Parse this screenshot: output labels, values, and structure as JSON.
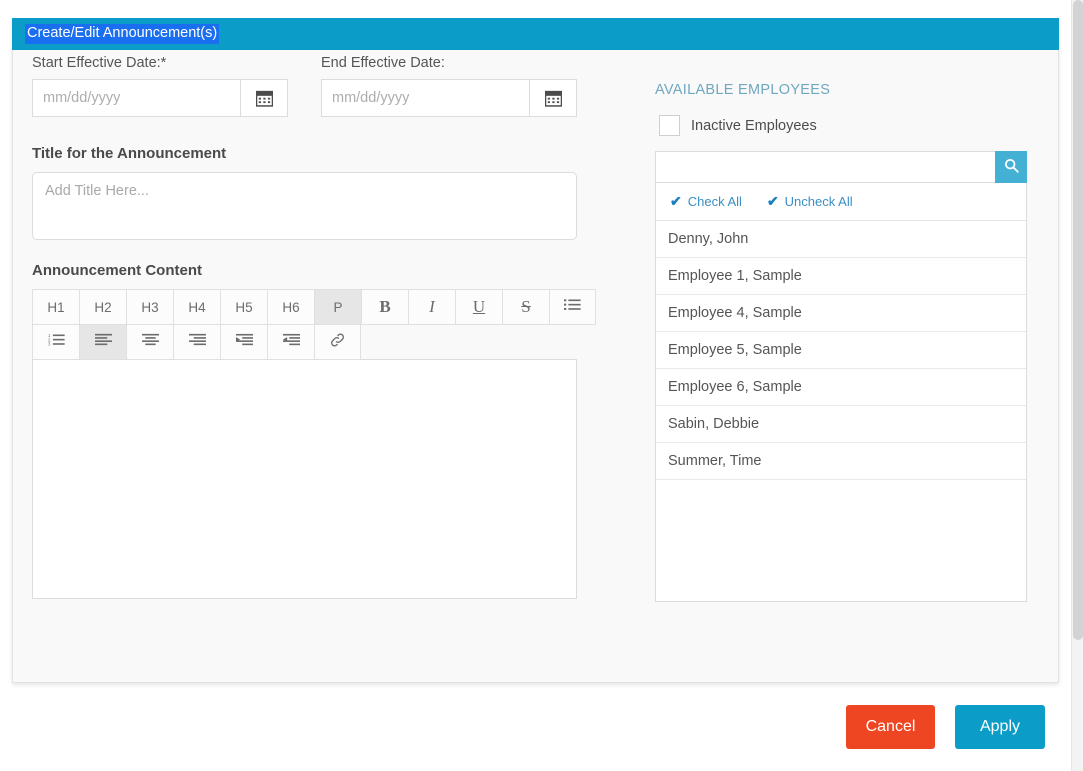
{
  "header": {
    "title": "Create/Edit Announcement(s)",
    "bar_color": "#0b9dc8",
    "selection_color": "#1a6ef0"
  },
  "form": {
    "start_date": {
      "label": "Start Effective Date:*",
      "value": "",
      "placeholder": "mm/dd/yyyy",
      "calendar_icon": "calendar-icon"
    },
    "end_date": {
      "label": "End Effective Date:",
      "value": "",
      "placeholder": "mm/dd/yyyy",
      "calendar_icon": "calendar-icon"
    },
    "title_field": {
      "label": "Title for the Announcement",
      "value": "",
      "placeholder": "Add Title Here..."
    },
    "content_field": {
      "label": "Announcement Content",
      "value": ""
    }
  },
  "toolbar": {
    "row1": [
      {
        "label": "H1",
        "name": "heading-1-button",
        "active": false,
        "style": "hx"
      },
      {
        "label": "H2",
        "name": "heading-2-button",
        "active": false,
        "style": "hx"
      },
      {
        "label": "H3",
        "name": "heading-3-button",
        "active": false,
        "style": "hx"
      },
      {
        "label": "H4",
        "name": "heading-4-button",
        "active": false,
        "style": "hx"
      },
      {
        "label": "H5",
        "name": "heading-5-button",
        "active": false,
        "style": "hx"
      },
      {
        "label": "H6",
        "name": "heading-6-button",
        "active": false,
        "style": "hx"
      },
      {
        "label": "P",
        "name": "paragraph-button",
        "active": true,
        "style": "pp"
      },
      {
        "label": "B",
        "name": "bold-button",
        "active": false,
        "style": "bb"
      },
      {
        "label": "I",
        "name": "italic-button",
        "active": false,
        "style": "ii"
      },
      {
        "label": "U",
        "name": "underline-button",
        "active": false,
        "style": "uu"
      },
      {
        "label": "S",
        "name": "strikethrough-button",
        "active": false,
        "style": "ss"
      },
      {
        "label": "",
        "name": "unordered-list-button",
        "active": false,
        "style": "icon",
        "icon": "bullet-list-icon"
      }
    ],
    "row2": [
      {
        "label": "",
        "name": "ordered-list-button",
        "active": false,
        "icon": "numbered-list-icon"
      },
      {
        "label": "",
        "name": "align-left-button",
        "active": true,
        "icon": "align-left-icon"
      },
      {
        "label": "",
        "name": "align-center-button",
        "active": false,
        "icon": "align-center-icon"
      },
      {
        "label": "",
        "name": "align-right-button",
        "active": false,
        "icon": "align-right-icon"
      },
      {
        "label": "",
        "name": "indent-button",
        "active": false,
        "icon": "indent-icon"
      },
      {
        "label": "",
        "name": "outdent-button",
        "active": false,
        "icon": "outdent-icon"
      },
      {
        "label": "",
        "name": "insert-link-button",
        "active": false,
        "icon": "link-icon"
      }
    ]
  },
  "employees_panel": {
    "title": "AVAILABLE EMPLOYEES",
    "title_color": "#6fa8bf",
    "inactive_checkbox": {
      "label": "Inactive Employees",
      "checked": false
    },
    "search": {
      "value": "",
      "placeholder": "",
      "button_icon": "search-icon",
      "button_color": "#43b0d4"
    },
    "check_all": {
      "label": "Check All",
      "icon": "check-icon"
    },
    "uncheck_all": {
      "label": "Uncheck All",
      "icon": "check-icon"
    },
    "employees": [
      {
        "name": "Denny, John"
      },
      {
        "name": "Employee 1, Sample"
      },
      {
        "name": "Employee 4, Sample"
      },
      {
        "name": "Employee 5, Sample"
      },
      {
        "name": "Employee 6, Sample"
      },
      {
        "name": "Sabin, Debbie"
      },
      {
        "name": "Summer, Time"
      }
    ]
  },
  "footer": {
    "cancel_label": "Cancel",
    "cancel_color": "#ee4623",
    "apply_label": "Apply",
    "apply_color": "#0b9dc8"
  }
}
